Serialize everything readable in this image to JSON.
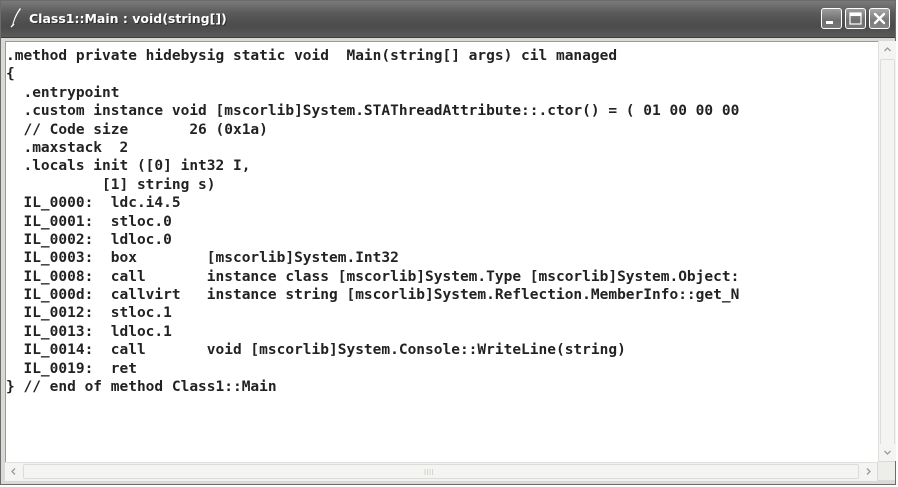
{
  "window": {
    "title": "Class1::Main : void(string[])",
    "app_icon": "quill-icon",
    "buttons": {
      "minimize_icon": "minimize-icon",
      "maximize_icon": "maximize-icon",
      "close_icon": "close-icon"
    }
  },
  "code": {
    "lines": [
      ".method private hidebysig static void  Main(string[] args) cil managed",
      "{",
      "  .entrypoint",
      "  .custom instance void [mscorlib]System.STAThreadAttribute::.ctor() = ( 01 00 00 00",
      "  // Code size       26 (0x1a)",
      "  .maxstack  2",
      "  .locals init ([0] int32 I,",
      "           [1] string s)",
      "  IL_0000:  ldc.i4.5",
      "  IL_0001:  stloc.0",
      "  IL_0002:  ldloc.0",
      "  IL_0003:  box        [mscorlib]System.Int32",
      "  IL_0008:  call       instance class [mscorlib]System.Type [mscorlib]System.Object:",
      "  IL_000d:  callvirt   instance string [mscorlib]System.Reflection.MemberInfo::get_N",
      "  IL_0012:  stloc.1",
      "  IL_0013:  ldloc.1",
      "  IL_0014:  call       void [mscorlib]System.Console::WriteLine(string)",
      "  IL_0019:  ret",
      "} // end of method Class1::Main"
    ]
  },
  "scrollbars": {
    "up_icon": "scroll-up-arrow-icon",
    "down_icon": "scroll-down-arrow-icon",
    "left_icon": "scroll-left-arrow-icon",
    "right_icon": "scroll-right-arrow-icon"
  }
}
